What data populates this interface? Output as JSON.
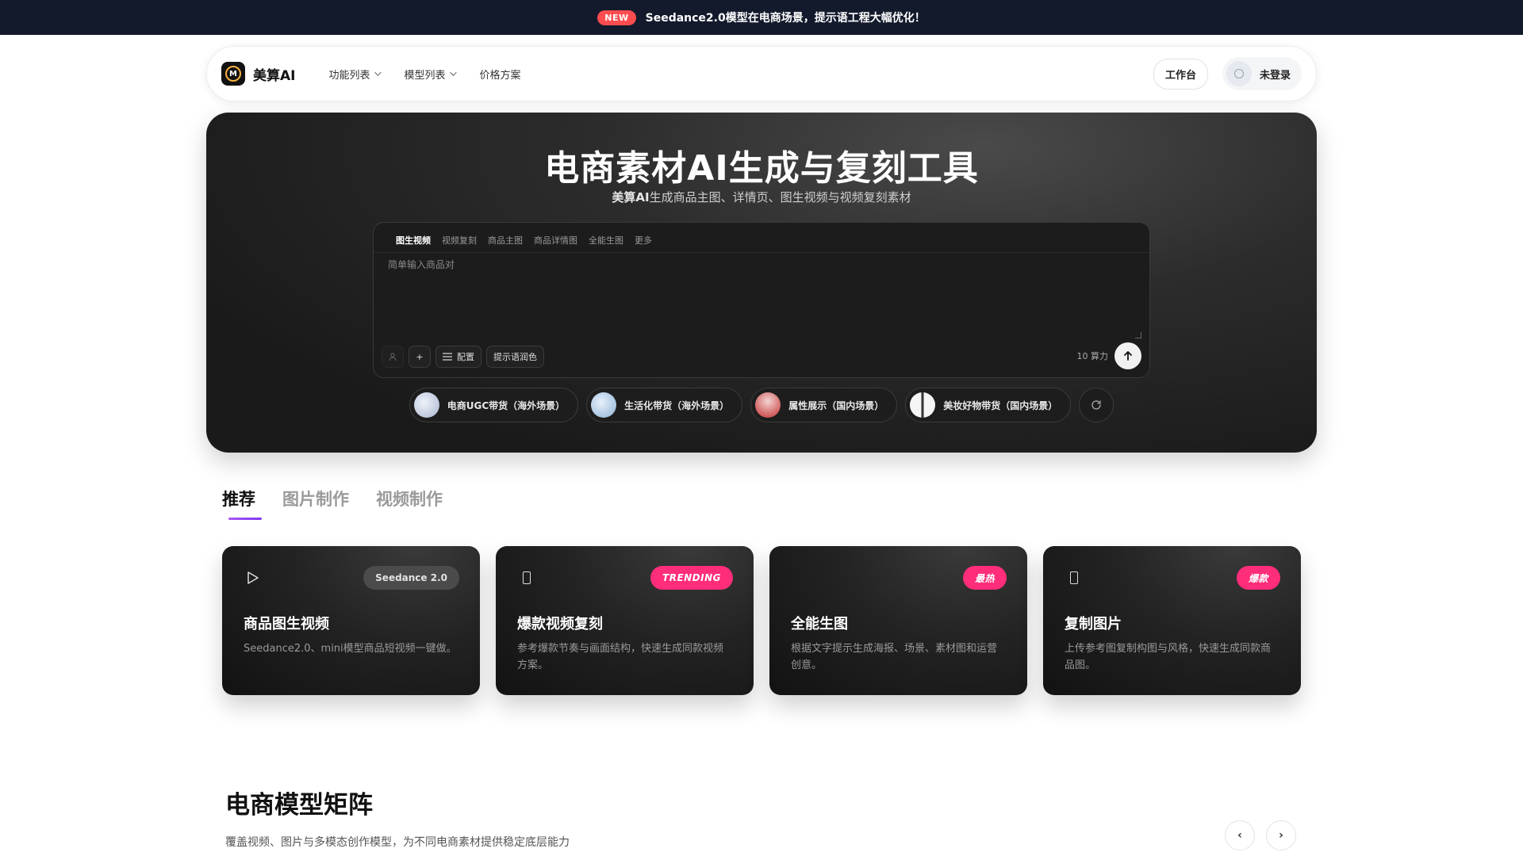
{
  "announcement": {
    "badge": "NEW",
    "text": "Seedance2.0模型在电商场景，提示语工程大幅优化！"
  },
  "nav": {
    "brand": "美算AI",
    "logo_letter": "M",
    "menu": [
      {
        "label": "功能列表",
        "has_dropdown": true
      },
      {
        "label": "模型列表",
        "has_dropdown": true
      },
      {
        "label": "价格方案",
        "has_dropdown": false
      }
    ],
    "workbench": "工作台",
    "login": "未登录"
  },
  "hero": {
    "title": "电商素材AI生成与复刻工具",
    "subtitle_prefix": "美算AI",
    "subtitle": "生成商品主图、详情页、图生视频与视频复刻素材",
    "composer": {
      "tabs": [
        "图生视频",
        "视频复刻",
        "商品主图",
        "商品详情图",
        "全能生图",
        "更多"
      ],
      "active_tab": "图生视频",
      "placeholder": "简单输入商品对",
      "tools": {
        "add": "+",
        "config": "配置",
        "polish": "提示语润色"
      },
      "credits": "10 算力",
      "send_icon": "arrow-up-icon"
    },
    "scenes": [
      {
        "label": "电商UGC带货（海外场景）",
        "thumb_color": "#c9d3e6"
      },
      {
        "label": "生活化带货（海外场景）",
        "thumb_color": "#b7d0ea"
      },
      {
        "label": "属性展示（国内场景）",
        "thumb_color": "#d64545"
      },
      {
        "label": "美妆好物带货（国内场景）",
        "thumb_color": "#e9e9e9"
      }
    ]
  },
  "category_tabs": [
    "推荐",
    "图片制作",
    "视频制作"
  ],
  "active_category": "推荐",
  "cards": [
    {
      "icon": "play-icon",
      "badge": "Seedance 2.0",
      "badge_style": "grey",
      "title": "商品图生视频",
      "desc": "Seedance2.0、mini模型商品短视频一键做。"
    },
    {
      "icon": "phone-icon",
      "badge": "TRENDING",
      "badge_style": "pink",
      "title": "爆款视频复刻",
      "desc": "参考爆款节奏与画面结构，快速生成同款视频方案。"
    },
    {
      "icon": "image-icon",
      "badge": "最热",
      "badge_style": "pink",
      "title": "全能生图",
      "desc": "根据文字提示生成海报、场景、素材图和运营创意。"
    },
    {
      "icon": "copy-icon",
      "badge": "爆款",
      "badge_style": "pink",
      "title": "复制图片",
      "desc": "上传参考图复制构图与风格，快速生成同款商品图。"
    }
  ],
  "model_section": {
    "title": "电商模型矩阵",
    "subtitle": "覆盖视频、图片与多模态创作模型，为不同电商素材提供稳定底层能力",
    "prev": "‹",
    "next": "›"
  },
  "colors": {
    "accent": "#7c3aed",
    "pink": "#ff2d7a",
    "announce_bg": "#131a2c",
    "new_badge": "#ff4d4f"
  }
}
